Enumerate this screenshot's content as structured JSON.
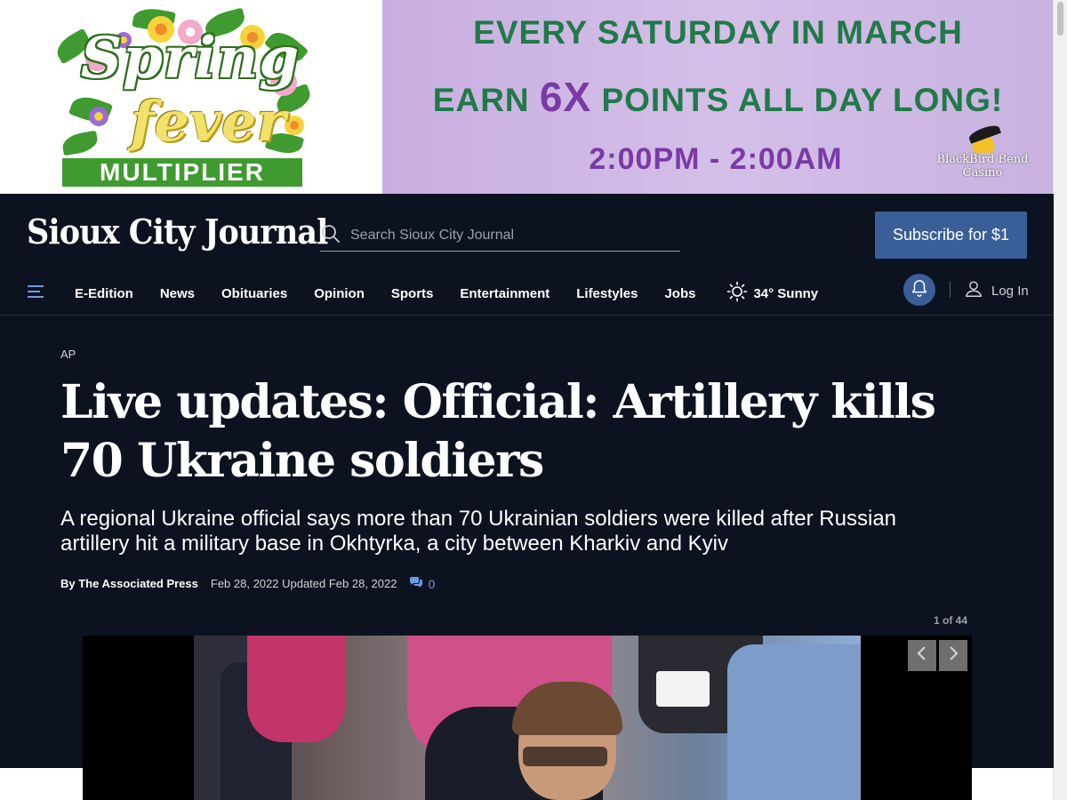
{
  "ad": {
    "spring_text": "Spring",
    "fever_text": "fever",
    "multiplier_text": "MULTIPLIER",
    "line1": "EVERY SATURDAY IN MARCH",
    "line2_prefix": "EARN ",
    "line2_highlight": "6X",
    "line2_suffix": " POINTS ALL DAY LONG!",
    "line3": "2:00PM - 2:00AM",
    "casino_line1": "BlackBird Bend",
    "casino_line2": "Casino"
  },
  "header": {
    "masthead": "Sioux City Journal",
    "search_placeholder": "Search Sioux City Journal",
    "subscribe_label": "Subscribe for $1"
  },
  "nav": {
    "items": [
      "E-Edition",
      "News",
      "Obituaries",
      "Opinion",
      "Sports",
      "Entertainment",
      "Lifestyles",
      "Jobs"
    ],
    "weather": "34° Sunny",
    "login": "Log In"
  },
  "article": {
    "kicker": "AP",
    "headline": "Live updates: Official: Artillery kills 70 Ukraine soldiers",
    "dek": "A regional Ukraine official says more than 70 Ukrainian soldiers were killed after Russian artillery hit a military base in Okhtyrka, a city between Kharkiv and Kyiv",
    "byline": "By The Associated Press",
    "date": "Feb 28, 2022 Updated Feb 28, 2022",
    "comments": "0"
  },
  "gallery": {
    "counter": "1 of 44"
  },
  "colors": {
    "site_bg": "#0c1220",
    "accent": "#3a5f98",
    "comment_link": "#6e9be0",
    "promo_green": "#1f7a48",
    "promo_purple": "#7a3aa6"
  }
}
